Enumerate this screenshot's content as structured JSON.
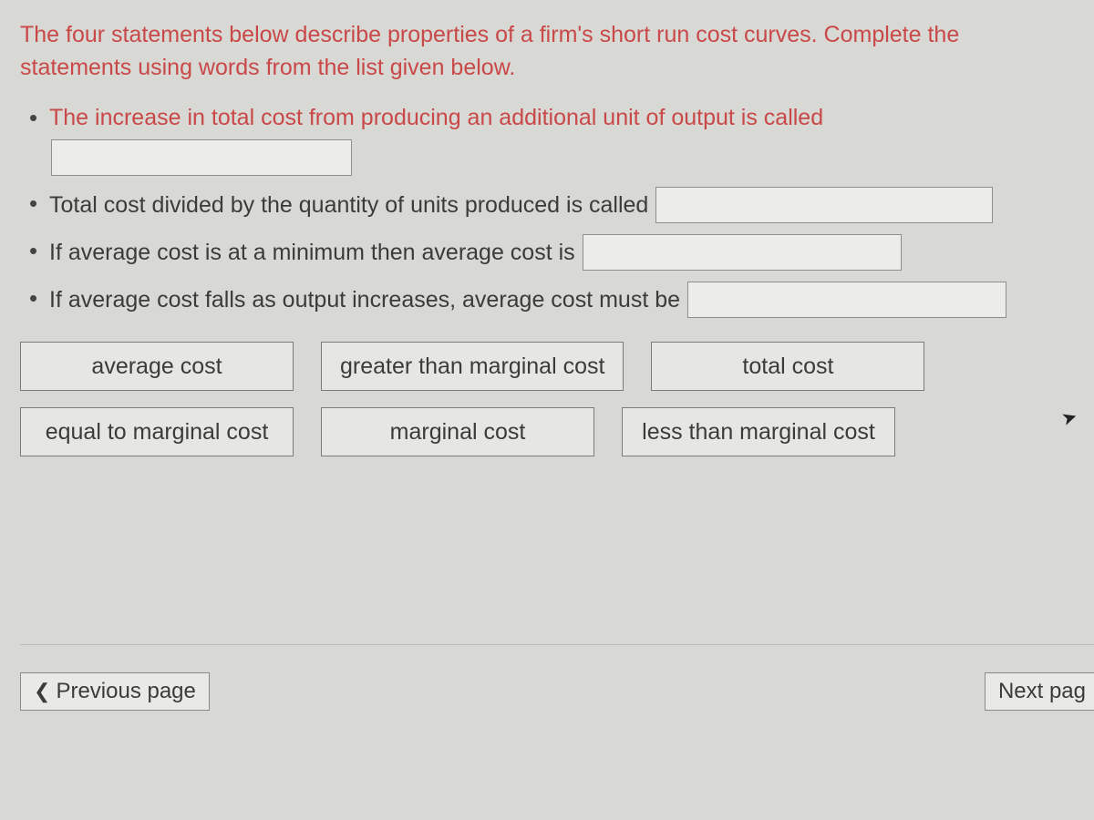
{
  "intro": "The four statements below describe properties of a firm's short run cost curves.  Complete the statements using words from the list given below.",
  "statements": {
    "items": [
      {
        "text": "The increase in total cost from producing an additional unit of output is called",
        "highlight": true,
        "slot_below": true
      },
      {
        "text": "Total cost divided by the quantity of units produced is called",
        "highlight": false,
        "slot_below": false
      },
      {
        "text": "If average cost is at a minimum then average cost is",
        "highlight": false,
        "slot_below": false
      },
      {
        "text": "If average cost falls as output increases, average cost must be",
        "highlight": false,
        "slot_below": false
      }
    ]
  },
  "wordbank": {
    "tiles": [
      "average cost",
      "greater than marginal cost",
      "total cost",
      "equal to marginal cost",
      "marginal cost",
      "less than marginal cost"
    ]
  },
  "nav": {
    "prev_label": "Previous page",
    "next_label": "Next pag"
  }
}
